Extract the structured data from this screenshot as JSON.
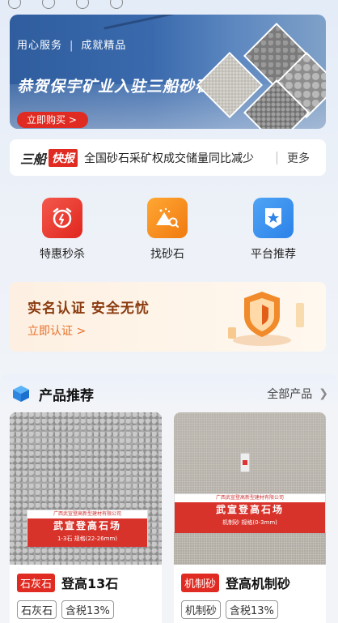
{
  "top_strip": {
    "items": [
      "",
      "",
      "",
      ""
    ]
  },
  "banner": {
    "subtitle_left": "用心服务",
    "subtitle_sep": "|",
    "subtitle_right": "成就精品",
    "title": "恭贺保宇矿业入驻三船砂石",
    "buy_label": "立即购买 >",
    "page_count": 5,
    "active_page": 0
  },
  "news": {
    "brand": "三船",
    "flash": "快报",
    "message": "全国砂石采矿权成交储量同比减少",
    "more": "更多"
  },
  "quick": [
    {
      "label": "特惠秒杀",
      "icon": "alarm-clock-icon"
    },
    {
      "label": "找砂石",
      "icon": "sand-search-icon"
    },
    {
      "label": "平台推荐",
      "icon": "star-badge-icon"
    }
  ],
  "verify": {
    "title": "实名认证  安全无忧",
    "link": "立即认证 >"
  },
  "products": {
    "title": "产品推荐",
    "all": "全部产品",
    "items": [
      {
        "category": "石灰石",
        "name": "登高13石",
        "tags": [
          "石灰石",
          "含税13%"
        ],
        "sign_company": "广西武宣登高新型建材有限公司",
        "sign_title": "武宣登高石场",
        "sign_spec": "1-3石  规格(22-26mm)"
      },
      {
        "category": "机制砂",
        "name": "登高机制砂",
        "tags": [
          "机制砂",
          "含税13%"
        ],
        "sign_company": "广西武宣登高新型建材有限公司",
        "sign_title": "武宣登高石场",
        "sign_spec": "机制砂  规格(0-3mm)"
      }
    ]
  },
  "colors": {
    "accent_red": "#e02b22",
    "orange": "#f07a10",
    "blue": "#2c82e8"
  }
}
